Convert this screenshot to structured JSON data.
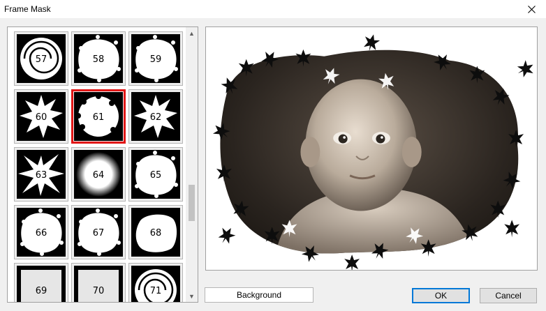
{
  "window": {
    "title": "Frame Mask",
    "close_icon": "close-icon"
  },
  "masks": [
    {
      "number": "57",
      "style": "swirl"
    },
    {
      "number": "58",
      "style": "splash"
    },
    {
      "number": "59",
      "style": "splash"
    },
    {
      "number": "60",
      "style": "star"
    },
    {
      "number": "61",
      "style": "leaves"
    },
    {
      "number": "62",
      "style": "star"
    },
    {
      "number": "63",
      "style": "spiky"
    },
    {
      "number": "64",
      "style": "soft"
    },
    {
      "number": "65",
      "style": "dotted"
    },
    {
      "number": "66",
      "style": "grainy"
    },
    {
      "number": "67",
      "style": "rough"
    },
    {
      "number": "68",
      "style": "blob"
    },
    {
      "number": "69",
      "style": "square"
    },
    {
      "number": "70",
      "style": "square"
    },
    {
      "number": "71",
      "style": "swirl"
    }
  ],
  "selected_mask": "61",
  "scroll_position": 0.68,
  "buttons": {
    "background": "Background",
    "ok": "OK",
    "cancel": "Cancel"
  },
  "colors": {
    "selection": "#e21616",
    "ok_border": "#0078d7"
  }
}
